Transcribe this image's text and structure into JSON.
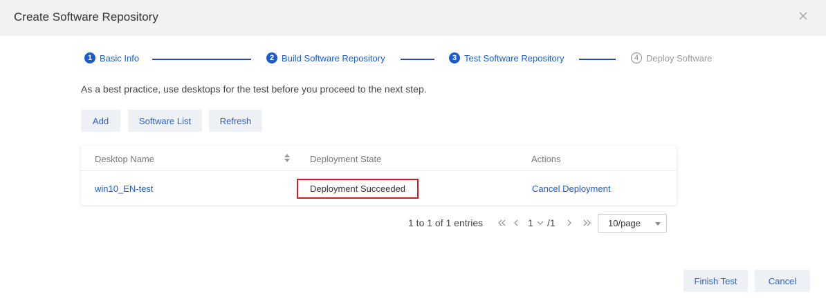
{
  "dialog": {
    "title": "Create Software Repository"
  },
  "steps": [
    {
      "number": "1",
      "label": "Basic Info",
      "state": "done"
    },
    {
      "number": "2",
      "label": "Build Software Repository",
      "state": "done"
    },
    {
      "number": "3",
      "label": "Test Software Repository",
      "state": "current"
    },
    {
      "number": "4",
      "label": "Deploy Software",
      "state": "pending"
    }
  ],
  "hint": "As a best practice, use desktops for the test before you proceed to the next step.",
  "toolbar": {
    "add": "Add",
    "software_list": "Software List",
    "refresh": "Refresh"
  },
  "table": {
    "columns": [
      "Desktop Name",
      "Deployment State",
      "Actions"
    ],
    "rows": [
      {
        "desktop_name": "win10_EN-test",
        "state": "Deployment Succeeded",
        "action": "Cancel Deployment"
      }
    ]
  },
  "pagination": {
    "summary": "1 to 1 of 1 entries",
    "current_page": "1",
    "total_pages": "/1",
    "page_size": "10/page"
  },
  "footer": {
    "finish": "Finish Test",
    "cancel": "Cancel"
  },
  "colors": {
    "accent": "#1a5bd0",
    "highlight_border": "#e0161c",
    "button_bg": "#edf0f4"
  }
}
